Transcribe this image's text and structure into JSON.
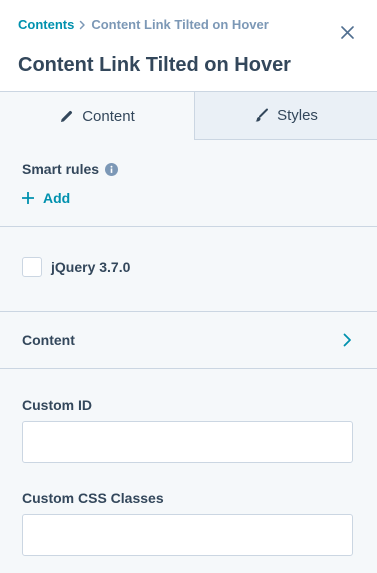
{
  "header": {
    "breadcrumb_root": "Contents",
    "breadcrumb_current": "Content Link Tilted on Hover",
    "title": "Content Link Tilted on Hover"
  },
  "tabs": [
    {
      "label": "Content",
      "icon": "pencil-icon",
      "active": true
    },
    {
      "label": "Styles",
      "icon": "brush-icon",
      "active": false
    }
  ],
  "smart_rules": {
    "label": "Smart rules",
    "add_label": "Add"
  },
  "jquery": {
    "label": "jQuery 3.7.0",
    "checked": false
  },
  "content_section": {
    "label": "Content"
  },
  "fields": {
    "custom_id": {
      "label": "Custom ID",
      "value": "",
      "placeholder": ""
    },
    "custom_css": {
      "label": "Custom CSS Classes",
      "value": "",
      "placeholder": ""
    }
  },
  "colors": {
    "accent": "#0091ae",
    "text": "#33475b",
    "muted": "#7c98b6",
    "border": "#cbd6e2",
    "panel_bg": "#f5f8fa"
  }
}
